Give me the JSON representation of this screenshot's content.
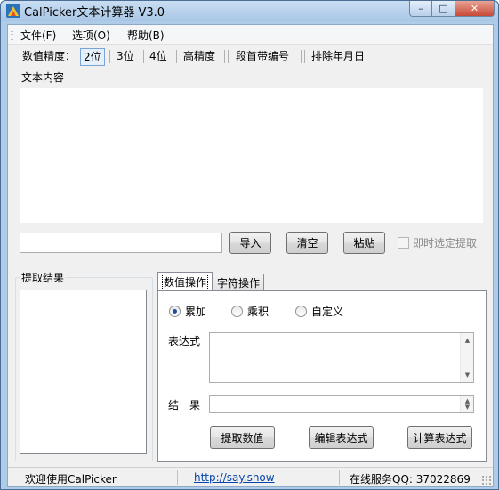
{
  "window": {
    "title": "CalPicker文本计算器 V3.0",
    "buttons": {
      "minimize": "–",
      "maximize": "□",
      "close": "✕"
    }
  },
  "menu": [
    {
      "label": "文件(F)"
    },
    {
      "label": "选项(O)"
    },
    {
      "label": "帮助(B)"
    }
  ],
  "toolbar": {
    "precision_label": "数值精度：",
    "items": [
      {
        "label": "2位",
        "selected": true
      },
      {
        "label": "3位",
        "selected": false
      },
      {
        "label": "4位",
        "selected": false
      },
      {
        "label": "高精度",
        "selected": false
      },
      {
        "label": "段首带编号",
        "selected": false
      },
      {
        "label": "排除年月日",
        "selected": false
      }
    ]
  },
  "text_panel": {
    "label": "文本内容",
    "content": "",
    "path_input": "",
    "import_button": "导入",
    "clear_button": "清空",
    "paste_button": "粘贴",
    "instant_extract_label": "即时选定提取",
    "instant_extract_checked": false
  },
  "result_panel": {
    "label": "提取结果",
    "items": []
  },
  "tabs": [
    {
      "label": "数值操作",
      "active": true
    },
    {
      "label": "字符操作",
      "active": false
    }
  ],
  "numeric_ops": {
    "modes": [
      {
        "label": "累加",
        "checked": true
      },
      {
        "label": "乘积",
        "checked": false
      },
      {
        "label": "自定义",
        "checked": false
      }
    ],
    "expression_label": "表达式",
    "expression_value": "",
    "result_label": "结　果",
    "result_value": "",
    "extract_button": "提取数值",
    "edit_button": "编辑表达式",
    "calc_button": "计算表达式"
  },
  "status": {
    "welcome": "欢迎使用CalPicker",
    "link": "http://say.show",
    "service": "在线服务QQ: 37022869"
  },
  "colors": {
    "title_gradient_top": "#c9def3",
    "close_button": "#c74a36",
    "link": "#0645ad",
    "radio_dot": "#1f4f9a"
  }
}
